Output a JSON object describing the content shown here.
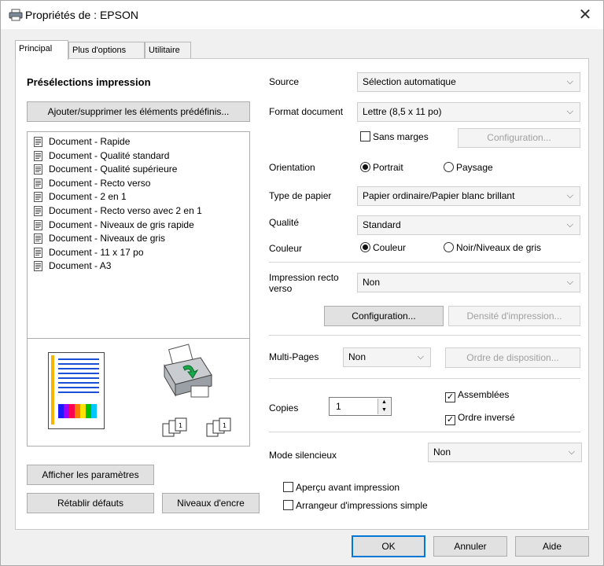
{
  "window": {
    "title": "Propriétés de : EPSON"
  },
  "tabs": [
    {
      "label": "Principal"
    },
    {
      "label": "Plus d'options"
    },
    {
      "label": "Utilitaire"
    }
  ],
  "presets": {
    "heading": "Présélections impression",
    "add_remove_button": "Ajouter/supprimer les éléments prédéfinis...",
    "items": [
      {
        "label": "Document - Rapide"
      },
      {
        "label": "Document - Qualité standard"
      },
      {
        "label": "Document - Qualité supérieure"
      },
      {
        "label": "Document - Recto verso"
      },
      {
        "label": "Document - 2 en 1"
      },
      {
        "label": "Document - Recto verso avec 2 en 1"
      },
      {
        "label": "Document - Niveaux de gris rapide"
      },
      {
        "label": "Document - Niveaux de gris"
      },
      {
        "label": "Document - 11 x 17 po"
      },
      {
        "label": "Document - A3"
      }
    ],
    "show_settings_button": "Afficher les paramètres",
    "reset_button": "Rétablir défauts",
    "ink_levels_button": "Niveaux d'encre"
  },
  "settings": {
    "source_label": "Source",
    "source_value": "Sélection automatique",
    "format_label": "Format document",
    "format_value": "Lettre (8,5 x 11 po)",
    "borderless_label": "Sans marges",
    "borderless_config_button": "Configuration...",
    "orientation_label": "Orientation",
    "portrait_label": "Portrait",
    "landscape_label": "Paysage",
    "paper_type_label": "Type de papier",
    "paper_type_value": "Papier ordinaire/Papier blanc brillant",
    "quality_label": "Qualité",
    "quality_value": "Standard",
    "color_label": "Couleur",
    "color_option": "Couleur",
    "gray_option": "Noir/Niveaux de gris",
    "duplex_label": "Impression recto verso",
    "duplex_value": "Non",
    "duplex_config_button": "Configuration...",
    "density_button": "Densité d'impression...",
    "multipage_label": "Multi-Pages",
    "multipage_value": "Non",
    "layout_order_button": "Ordre de disposition...",
    "copies_label": "Copies",
    "copies_value": "1",
    "collate_label": "Assemblées",
    "reverse_label": "Ordre inversé",
    "quiet_mode_label": "Mode silencieux",
    "quiet_mode_value": "Non",
    "preview_label": "Aperçu avant impression",
    "arranger_label": "Arrangeur d'impressions simple"
  },
  "footer": {
    "ok": "OK",
    "cancel": "Annuler",
    "help": "Aide"
  },
  "state": {
    "active_tab": "Principal",
    "borderless": false,
    "orientation": "Portrait",
    "color_mode": "Couleur",
    "collate": true,
    "reverse_order": true,
    "print_preview": false,
    "simple_arranger": false
  }
}
